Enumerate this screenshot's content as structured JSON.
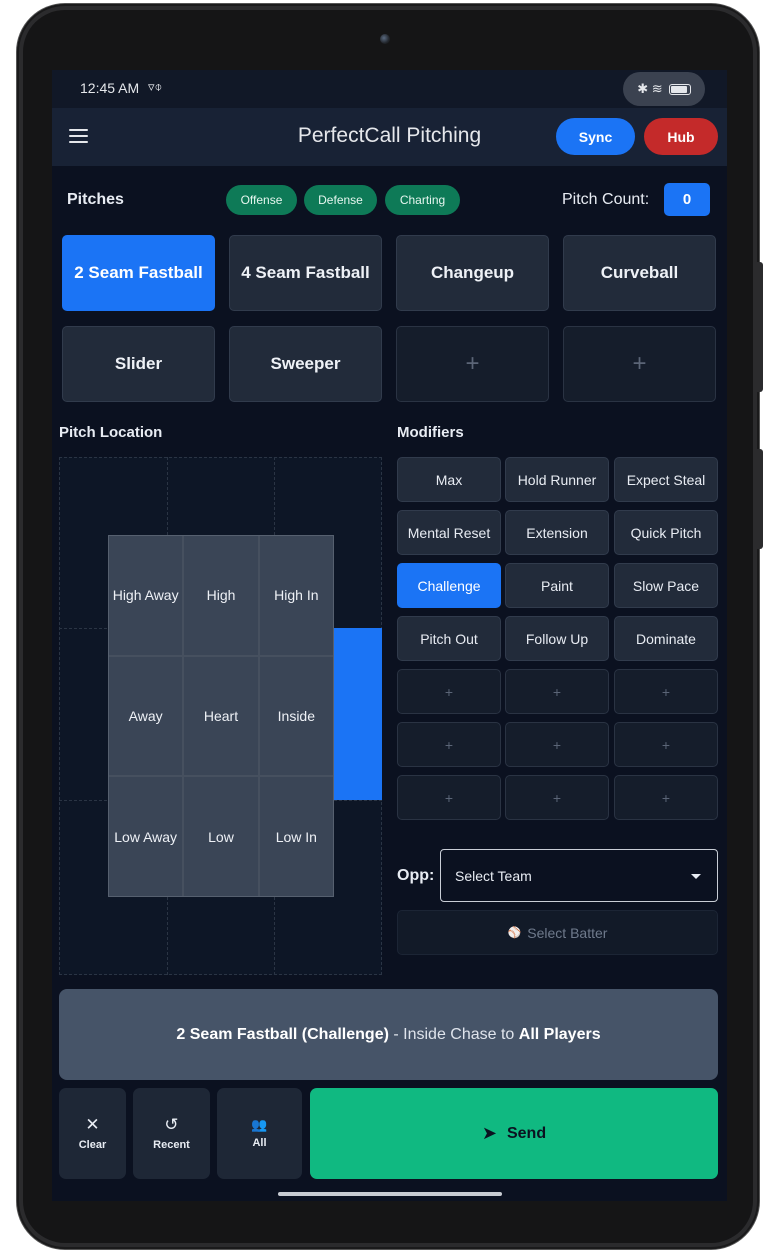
{
  "status_bar": {
    "time": "12:45 AM",
    "left_icons": "▿⌽",
    "right_icons": "✱ ≋"
  },
  "app_bar": {
    "title": "PerfectCall Pitching",
    "sync_label": "Sync",
    "hub_label": "Hub"
  },
  "pitches": {
    "label": "Pitches",
    "chips": [
      "Offense",
      "Defense",
      "Charting"
    ],
    "pitch_count_label": "Pitch Count:",
    "pitch_count_value": "0",
    "buttons": [
      "2 Seam Fastball",
      "4 Seam Fastball",
      "Changeup",
      "Curveball",
      "Slider",
      "Sweeper",
      "+",
      "+"
    ],
    "selected": "2 Seam Fastball"
  },
  "pitch_location": {
    "label": "Pitch Location",
    "zones": [
      "High Away",
      "High",
      "High In",
      "Away",
      "Heart",
      "Inside",
      "Low Away",
      "Low",
      "Low In"
    ],
    "selected_outer_zone": "Inside Chase"
  },
  "modifiers": {
    "label": "Modifiers",
    "buttons": [
      "Max",
      "Hold Runner",
      "Expect Steal",
      "Mental Reset",
      "Extension",
      "Quick Pitch",
      "Challenge",
      "Paint",
      "Slow Pace",
      "Pitch Out",
      "Follow Up",
      "Dominate",
      "+",
      "+",
      "+",
      "+",
      "+",
      "+",
      "+",
      "+",
      "+"
    ],
    "selected": "Challenge"
  },
  "opponent": {
    "label": "Opp:",
    "select_value": "Select Team",
    "batter_label": "Select Batter",
    "batter_icon": "⚾"
  },
  "summary": {
    "pitch": "2 Seam Fastball (Challenge)",
    "separator": " - Inside Chase to ",
    "target": "All Players"
  },
  "bottom": {
    "clear_label": "Clear",
    "clear_icon": "✕",
    "recent_label": "Recent",
    "recent_icon": "↺",
    "all_label": "All",
    "all_icon": "👥",
    "send_label": "Send",
    "send_icon": "➤"
  },
  "colors": {
    "accent": "#1b74f5",
    "danger": "#c42a2a",
    "success": "#10b981",
    "chip": "#0e7a57"
  }
}
